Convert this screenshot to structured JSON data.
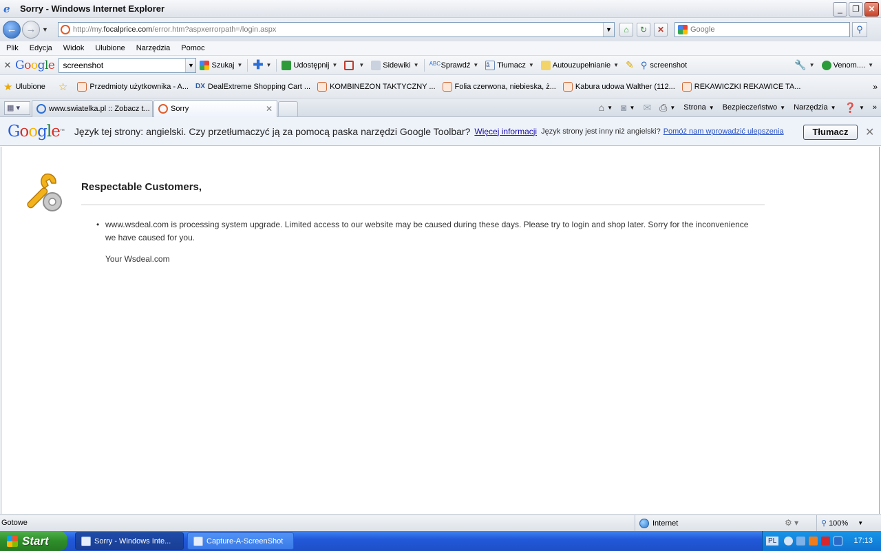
{
  "window": {
    "title": "Sorry - Windows Internet Explorer",
    "min": "_",
    "max": "❐",
    "close": "✕"
  },
  "address": {
    "prefix": "http://my.",
    "domain": "focalprice.com",
    "suffix": "/error.htm?aspxerrorpath=/login.aspx"
  },
  "search": {
    "placeholder": "Google"
  },
  "menu": [
    "Plik",
    "Edycja",
    "Widok",
    "Ulubione",
    "Narzędzia",
    "Pomoc"
  ],
  "google_toolbar": {
    "query": "screenshot",
    "items": {
      "search": "Szukaj",
      "share": "Udostępnij",
      "sidewiki": "Sidewiki",
      "check": "Sprawdź",
      "translate": "Tłumacz",
      "autofill": "Autouzupełnianie",
      "highlight_term": "screenshot",
      "account": "Venom...."
    }
  },
  "favorites": {
    "label": "Ulubione",
    "links": [
      "Przedmioty użytkownika - A...",
      "DealExtreme Shopping Cart ...",
      "KOMBINEZON TAKTYCZNY ...",
      "Folia czerwona, niebieska, ż...",
      "Kabura udowa Walther (112...",
      "REKAWICZKI REKAWICE TA..."
    ]
  },
  "tabs": [
    {
      "label": "www.swiatelka.pl :: Zobacz t..."
    },
    {
      "label": "Sorry"
    }
  ],
  "commands": {
    "page": "Strona",
    "safety": "Bezpieczeństwo",
    "tools": "Narzędzia"
  },
  "infobar": {
    "message": "Język tej strony: angielski. Czy przetłumaczyć ją za pomocą paska narzędzi Google Toolbar?",
    "more_info": "Więcej informacji",
    "not_english": "Język strony jest inny niż angielski?",
    "help_improve": "Pomóż nam wprowadzić ulepszenia",
    "translate_button": "Tłumacz"
  },
  "page": {
    "heading": "Respectable Customers,",
    "message": "www.wsdeal.com is processing system upgrade. Limited access to our website may be caused during these days. Please try to login and shop later. Sorry for the inconvenience we have caused for you.",
    "signature": "Your Wsdeal.com"
  },
  "status": {
    "text": "Gotowe",
    "zone": "Internet",
    "zoom": "100%"
  },
  "taskbar": {
    "start": "Start",
    "items": [
      "Sorry - Windows Inte...",
      "Capture-A-ScreenShot"
    ],
    "lang": "PL",
    "clock": "17:13"
  }
}
